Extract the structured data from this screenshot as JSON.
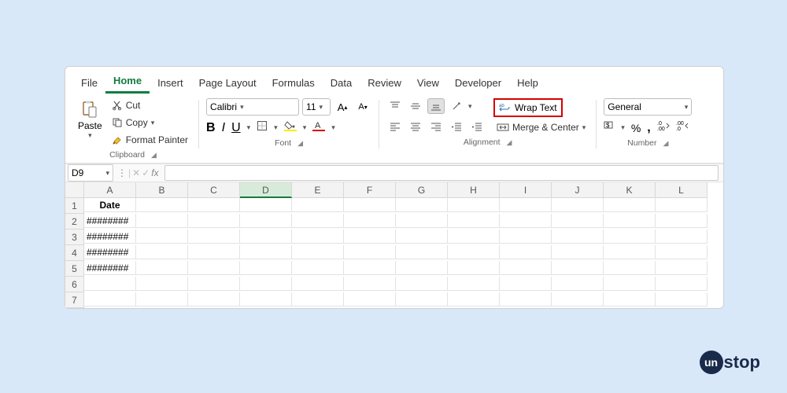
{
  "tabs": [
    "File",
    "Home",
    "Insert",
    "Page Layout",
    "Formulas",
    "Data",
    "Review",
    "View",
    "Developer",
    "Help"
  ],
  "active_tab": "Home",
  "clipboard": {
    "paste": "Paste",
    "cut": "Cut",
    "copy": "Copy",
    "format_painter": "Format Painter",
    "group": "Clipboard"
  },
  "font": {
    "name": "Calibri",
    "size": "11",
    "bold": "B",
    "italic": "I",
    "underline": "U",
    "group": "Font"
  },
  "alignment": {
    "wrap": "Wrap Text",
    "merge": "Merge & Center",
    "group": "Alignment"
  },
  "number": {
    "format": "General",
    "group": "Number"
  },
  "namebox": "D9",
  "fx": "fx",
  "columns": [
    "A",
    "B",
    "C",
    "D",
    "E",
    "F",
    "G",
    "H",
    "I",
    "J",
    "K",
    "L"
  ],
  "selected_col": "D",
  "rows": [
    1,
    2,
    3,
    4,
    5,
    6,
    7
  ],
  "cells": {
    "A1": "Date",
    "A2": "########",
    "A3": "########",
    "A4": "########",
    "A5": "########"
  },
  "brand": {
    "prefix": "un",
    "suffix": "stop"
  }
}
